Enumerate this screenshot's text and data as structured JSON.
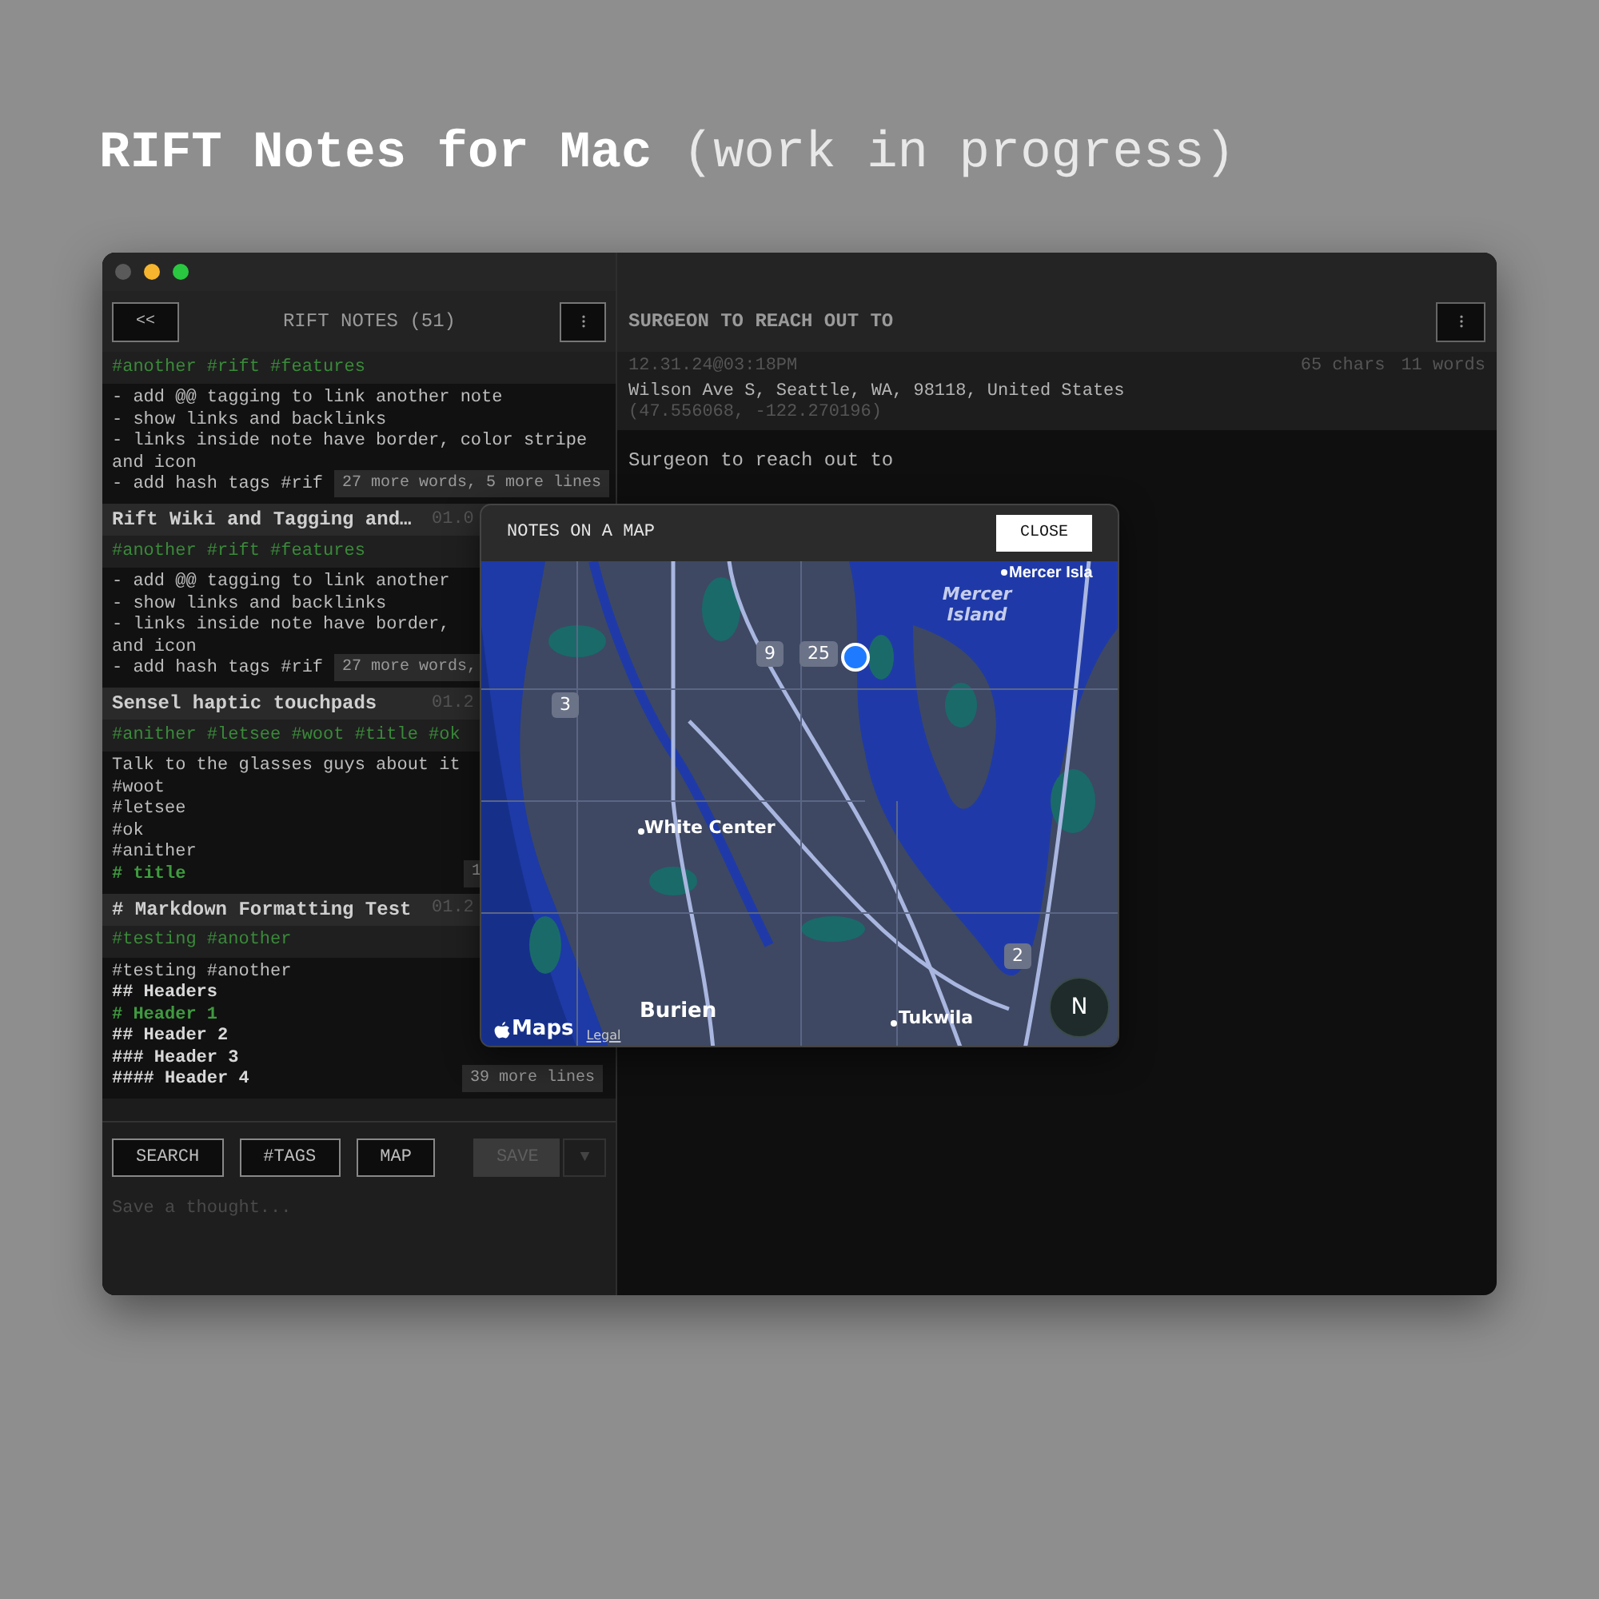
{
  "page_title": {
    "name": "RIFT Notes for Mac",
    "note": "(work in progress)"
  },
  "sidebar": {
    "back_button": "<<",
    "title": "RIFT NOTES (51)",
    "notes": [
      {
        "tags": "#another #rift #features",
        "body": [
          {
            "kind": "plain",
            "text": "- add @@ tagging to link another note"
          },
          {
            "kind": "plain",
            "text": "- show links and backlinks"
          },
          {
            "kind": "plain",
            "text": "- links inside note have border, color stripe"
          },
          {
            "kind": "plain",
            "text": "and icon"
          },
          {
            "kind": "plain",
            "text": "- add hash tags #rif"
          }
        ],
        "badge": "27 more words, 5 more lines"
      },
      {
        "title": "Rift Wiki and Tagging and…",
        "date": "01.0",
        "tags": "#another #rift #features",
        "body": [
          {
            "kind": "plain",
            "text": "- add @@ tagging to link another"
          },
          {
            "kind": "plain",
            "text": "- show links and backlinks"
          },
          {
            "kind": "plain",
            "text": "- links inside note have border,"
          },
          {
            "kind": "plain",
            "text": "and icon"
          },
          {
            "kind": "plain",
            "text": "- add hash tags #rif"
          }
        ],
        "badge": "27 more words,"
      },
      {
        "title": "Sensel haptic touchpads",
        "date": "01.2",
        "tags": "#anither #letsee #woot #title #ok",
        "body": [
          {
            "kind": "plain",
            "text": "Talk to the glasses guys about it"
          },
          {
            "kind": "plain",
            "text": "#woot"
          },
          {
            "kind": "plain",
            "text": "#letsee"
          },
          {
            "kind": "plain",
            "text": "#ok"
          },
          {
            "kind": "plain",
            "text": "#anither"
          },
          {
            "kind": "heading",
            "text": "# title"
          }
        ],
        "badge": "1"
      },
      {
        "title": "# Markdown Formatting Test",
        "date": "01.2",
        "tags": "#testing #another",
        "body": [
          {
            "kind": "plain",
            "text": "#testing #another"
          },
          {
            "kind": "bold",
            "text": "## Headers"
          },
          {
            "kind": "heading",
            "text": "# Header 1"
          },
          {
            "kind": "bold",
            "text": "## Header 2"
          },
          {
            "kind": "bold",
            "text": "### Header 3"
          },
          {
            "kind": "bold",
            "text": "#### Header 4"
          }
        ],
        "badge": "39 more lines"
      }
    ],
    "buttons": [
      {
        "label": "SEARCH",
        "disabled": false
      },
      {
        "label": "#TAGS",
        "disabled": false
      },
      {
        "label": "MAP",
        "disabled": false
      },
      {
        "label": "SAVE",
        "disabled": true
      }
    ],
    "dropdown": "▼",
    "composer": {
      "placeholder": "Save a thought..."
    }
  },
  "detail": {
    "title": "SURGEON TO REACH OUT TO",
    "timestamp": "12.31.24@03:18PM",
    "chars": "65 chars",
    "words": "11 words",
    "address": "Wilson Ave S, Seattle, WA, 98118, United States",
    "coordinates": "(47.556068, -122.270196)",
    "body": "Surgeon to reach out to"
  },
  "map_dialog": {
    "title": "NOTES ON A MAP",
    "close": "CLOSE",
    "clusters": [
      {
        "count": "9"
      },
      {
        "count": "25"
      },
      {
        "count": "3"
      },
      {
        "count": "2"
      }
    ],
    "places": [
      {
        "kind": "cut",
        "text": "Mercer Isla"
      },
      {
        "kind": "water",
        "text": "Mercer Island"
      },
      {
        "kind": "town",
        "text": "White Center"
      },
      {
        "kind": "city",
        "text": "Burien"
      },
      {
        "kind": "town",
        "text": "Tukwila"
      }
    ],
    "compass": "N",
    "brand": "Maps",
    "legal": "Legal"
  }
}
